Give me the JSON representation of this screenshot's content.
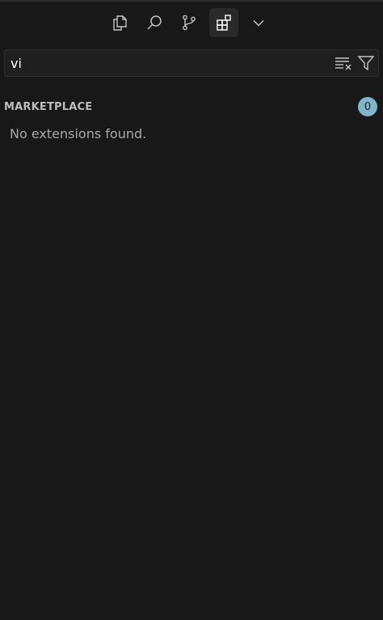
{
  "tabs": [
    {
      "icon": "explorer-icon",
      "active": false
    },
    {
      "icon": "search-icon",
      "active": false
    },
    {
      "icon": "source-control-icon",
      "active": false
    },
    {
      "icon": "extensions-icon",
      "active": true
    },
    {
      "icon": "chevron-down-icon",
      "active": false
    }
  ],
  "search": {
    "value": "vi"
  },
  "actions": {
    "clear_icon": "clear-filter-icon",
    "filter_icon": "filter-icon"
  },
  "section": {
    "title": "MARKETPLACE",
    "count": "0",
    "empty_message": "No extensions found."
  },
  "colors": {
    "background": "#181818",
    "badge": "#7fb6cc",
    "active_tab": "#2a2a2a"
  }
}
